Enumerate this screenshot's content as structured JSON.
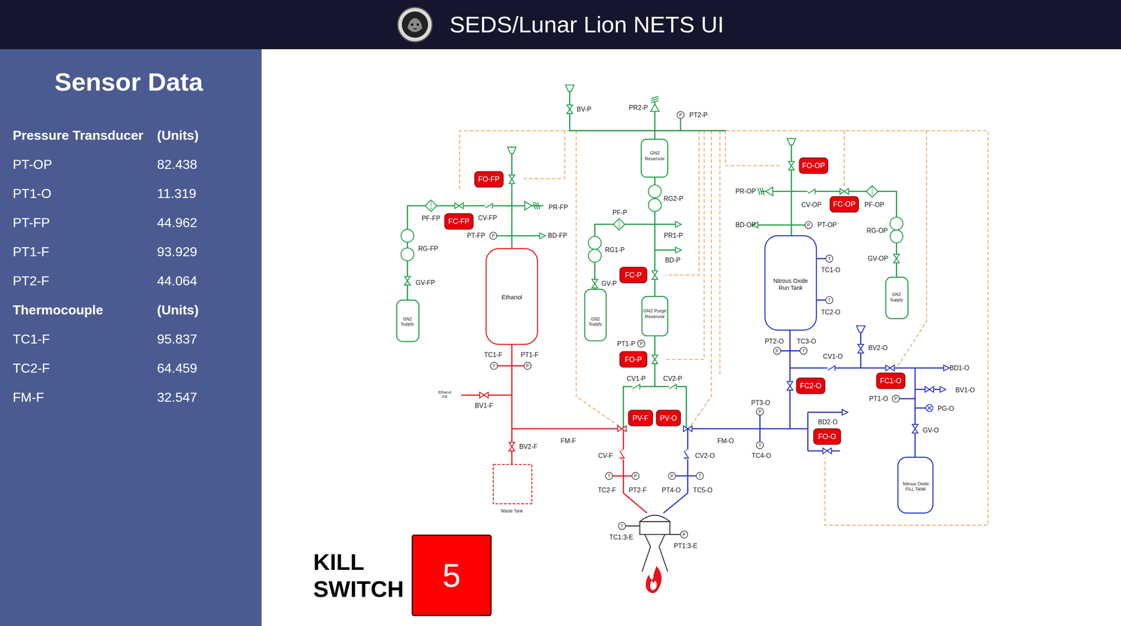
{
  "header": {
    "title": "SEDS/Lunar Lion NETS UI"
  },
  "sidebar": {
    "title": "Sensor Data",
    "sections": [
      {
        "heading": "Pressure Transducer",
        "units": "(Units)",
        "rows": [
          {
            "name": "PT-OP",
            "value": "82.438"
          },
          {
            "name": "PT1-O",
            "value": "11.319"
          },
          {
            "name": "PT-FP",
            "value": "44.962"
          },
          {
            "name": "PT1-F",
            "value": "93.929"
          },
          {
            "name": "PT2-F",
            "value": "44.064"
          }
        ]
      },
      {
        "heading": "Thermocouple",
        "units": "(Units)",
        "rows": [
          {
            "name": "TC1-F",
            "value": "95.837"
          },
          {
            "name": "TC2-F",
            "value": "64.459"
          },
          {
            "name": "FM-F",
            "value": "32.547"
          }
        ]
      }
    ]
  },
  "diagram": {
    "symbols": {
      "pressure": "P",
      "temperature": "T"
    },
    "tags": [
      "BV-P",
      "PR2-P",
      "PT2-P",
      "RG2-P",
      "PF-P",
      "PR1-P",
      "RG1-P",
      "BD-P",
      "GV-P",
      "PT1-P",
      "CV1-P",
      "CV2-P",
      "FM-F",
      "FM-O",
      "CV-F",
      "CV2-O",
      "TC2-F",
      "PT2-F",
      "PT4-O",
      "TC5-O",
      "TC1:3-E",
      "PT1:3-E",
      "PF-FP",
      "CV-FP",
      "PR-FP",
      "PT-FP",
      "BD-FP",
      "RG-FP",
      "GV-FP",
      "TC1-F",
      "PT1-F",
      "BV1-F",
      "BV2-F",
      "PR-OP",
      "CV-OP",
      "PF-OP",
      "BD-OP",
      "PT-OP",
      "RG-OP",
      "GV-OP",
      "TC1-O",
      "TC2-O",
      "PT2-O",
      "TC3-O",
      "CV1-O",
      "BV2-O",
      "BD1-O",
      "BV1-O",
      "PT1-O",
      "PG-O",
      "PT3-O",
      "TC4-O",
      "BD2-O",
      "GV-O"
    ],
    "actuators": [
      "FO-FP",
      "FC-FP",
      "FC-P",
      "FO-P",
      "PV-F",
      "PV-O",
      "FO-OP",
      "FC-OP",
      "FC2-O",
      "FC1-O",
      "FO-O"
    ],
    "vessels": [
      {
        "lines": [
          "GN2",
          "Reservoir"
        ]
      },
      {
        "lines": [
          "GN2",
          "Supply"
        ]
      },
      {
        "lines": [
          "GN2",
          "Supply"
        ]
      },
      {
        "lines": [
          "GN2 Purge",
          "Reservoir"
        ]
      },
      {
        "lines": [
          "Ethanol"
        ]
      },
      {
        "lines": [
          "Nitrous Oxide",
          "Run Tank"
        ]
      },
      {
        "lines": [
          "GN2",
          "Supply"
        ]
      },
      {
        "lines": [
          "Nitrous Oxide",
          "FILL TANK"
        ]
      },
      {
        "lines": [
          "Waste Tank"
        ]
      },
      {
        "lines": [
          "Ethanol",
          "Fill"
        ]
      }
    ]
  },
  "kill_switch": {
    "label": [
      "KILL",
      "SWITCH"
    ],
    "value": "5"
  }
}
